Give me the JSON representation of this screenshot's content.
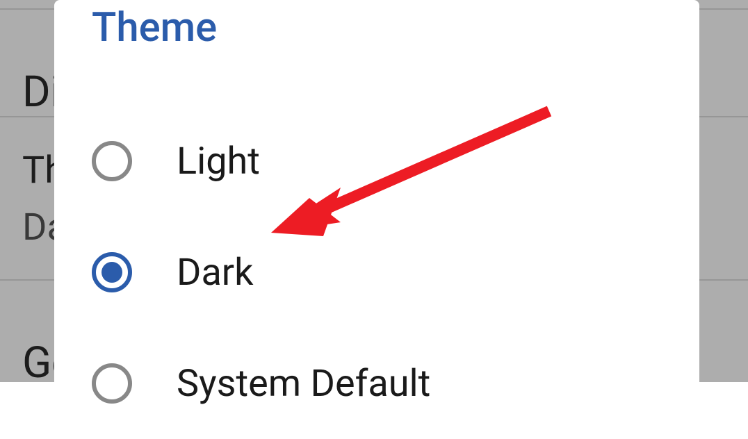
{
  "background": {
    "section1_partial": "Di",
    "section2_label_partial": "Th",
    "section2_value_partial": "Da",
    "section3_partial": "Ge"
  },
  "dialog": {
    "title": "Theme",
    "options": [
      {
        "label": "Light",
        "selected": false
      },
      {
        "label": "Dark",
        "selected": true
      },
      {
        "label": "System Default",
        "selected": false
      }
    ]
  },
  "annotation": {
    "type": "arrow",
    "color": "#ed1c24",
    "target": "Dark"
  }
}
